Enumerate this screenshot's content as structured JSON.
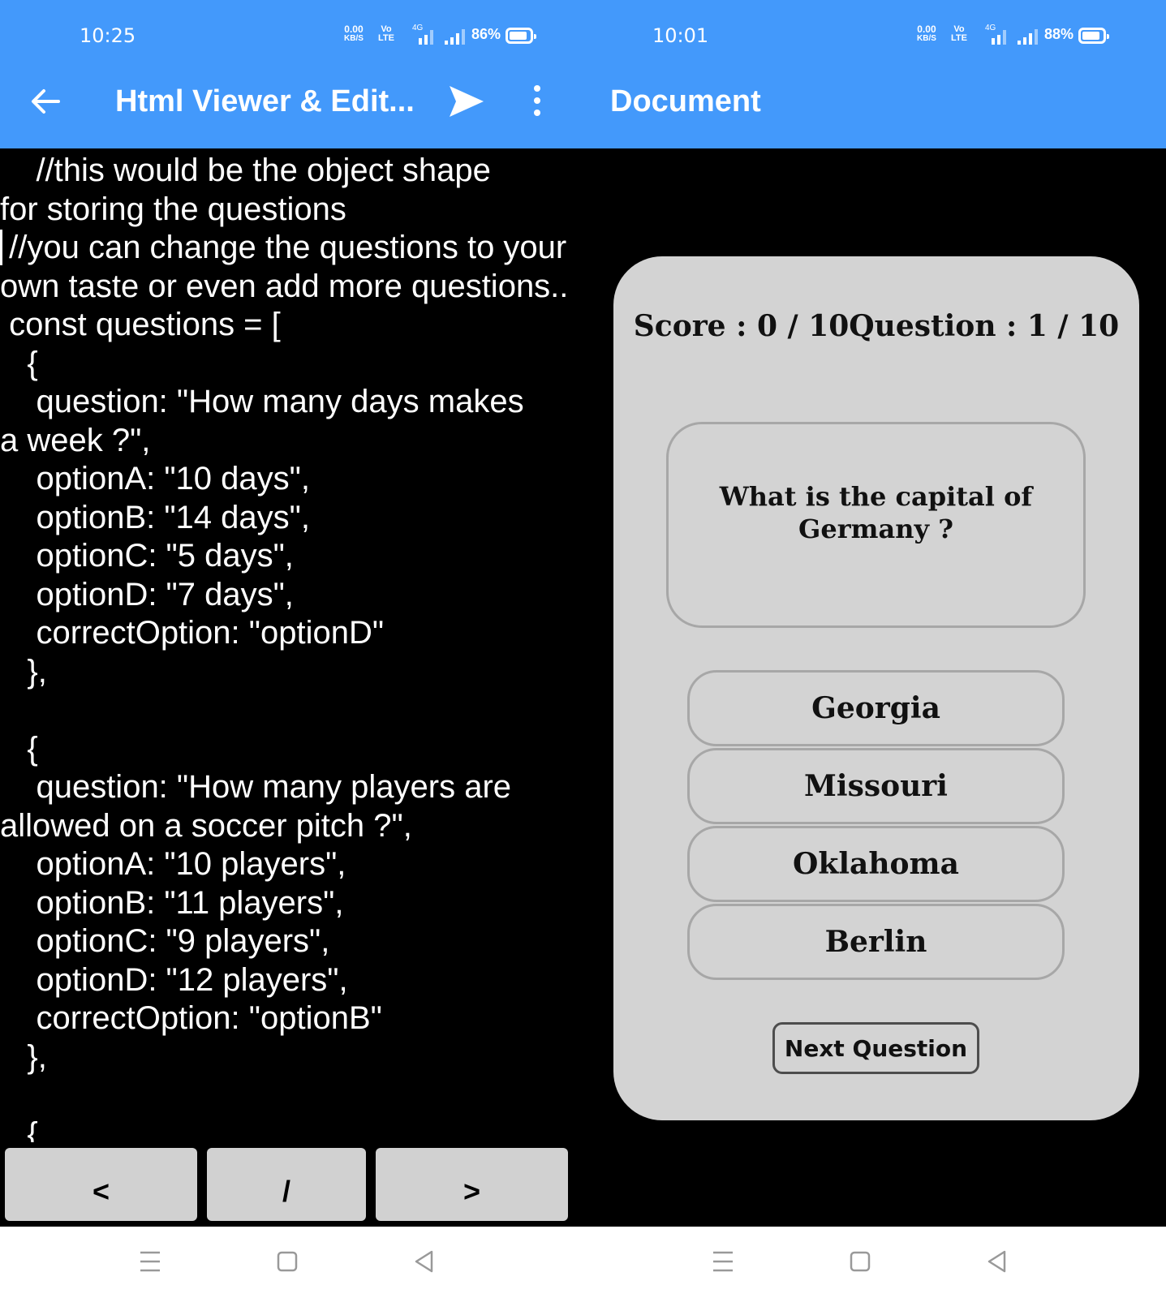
{
  "left_phone": {
    "status": {
      "time": "10:25",
      "net_speed_value": "0.00",
      "net_speed_unit": "KB/S",
      "volte_top": "Vo",
      "volte_bottom": "LTE",
      "network": "4G",
      "battery_pct": "86%",
      "battery_level": 0.86
    },
    "appbar": {
      "title": "Html Viewer & Edit...",
      "back_icon": "arrow-left-icon",
      "send_icon": "send-icon",
      "menu_icon": "more-vert-icon"
    },
    "code_lines": [
      "    //this would be the object shape",
      "for storing the questions",
      " //you can change the questions to your",
      "own taste or even add more questions..",
      " const questions = [",
      "   {",
      "    question: \"How many days makes",
      "a week ?\",",
      "    optionA: \"10 days\",",
      "    optionB: \"14 days\",",
      "    optionC: \"5 days\",",
      "    optionD: \"7 days\",",
      "    correctOption: \"optionD\"",
      "   },",
      "",
      "   {",
      "    question: \"How many players are",
      "allowed on a soccer pitch ?\",",
      "    optionA: \"10 players\",",
      "    optionB: \"11 players\",",
      "    optionC: \"9 players\",",
      "    optionD: \"12 players\",",
      "    correctOption: \"optionB\"",
      "   },",
      "",
      "   {"
    ],
    "keys": [
      "<",
      "/",
      ">"
    ]
  },
  "right_phone": {
    "status": {
      "time": "10:01",
      "net_speed_value": "0.00",
      "net_speed_unit": "KB/S",
      "volte_top": "Vo",
      "volte_bottom": "LTE",
      "network": "4G",
      "battery_pct": "88%",
      "battery_level": 0.88
    },
    "appbar": {
      "title": "Document"
    },
    "quiz": {
      "score_line": "Score : 0 / 10Question : 1 / 10",
      "question": "What is the capital of Germany ?",
      "options": [
        "Georgia",
        "Missouri",
        "Oklahoma",
        "Berlin"
      ],
      "next_label": "Next Question"
    }
  },
  "navbar": {
    "icons": [
      "menu-lines-icon",
      "home-square-icon",
      "back-triangle-icon"
    ]
  },
  "colors": {
    "appbar": "#4399fb",
    "card": "#d3d3d3",
    "key": "#d1d1d1",
    "background": "#000000"
  }
}
